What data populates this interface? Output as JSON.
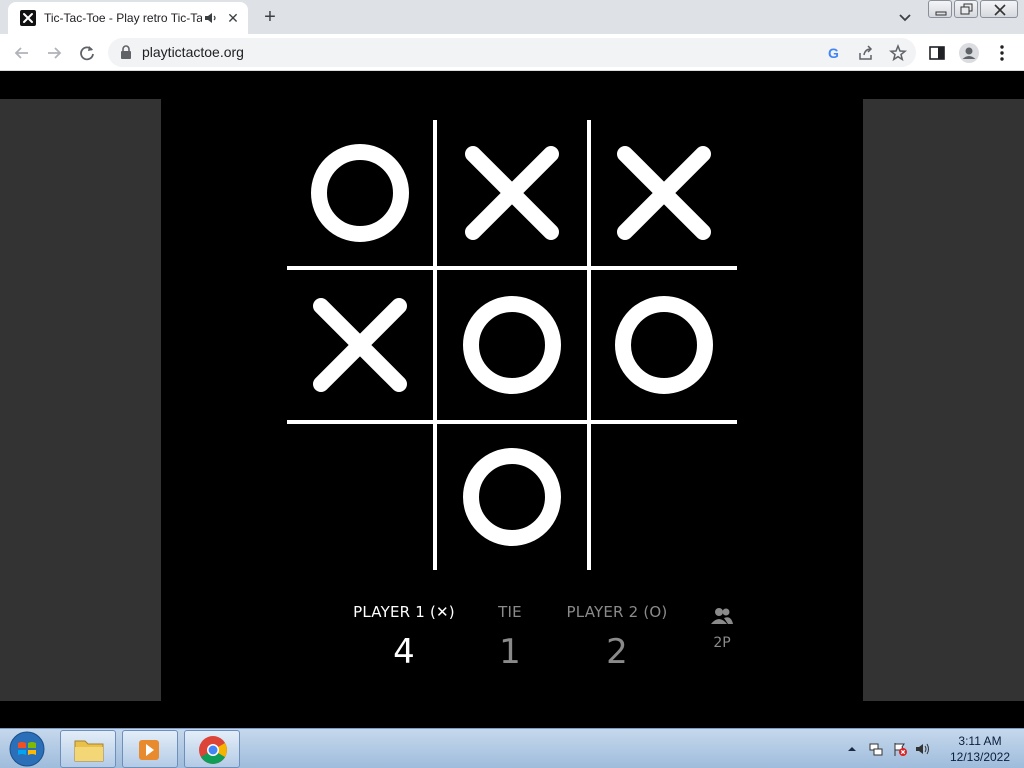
{
  "browser": {
    "tab_title": "Tic-Tac-Toe - Play retro Tic-Tac-Toe online for free",
    "tab_close_glyph": "✕",
    "new_tab_glyph": "+",
    "url": "playtictactoe.org"
  },
  "game": {
    "board": [
      "O",
      "X",
      "X",
      "X",
      "O",
      "O",
      "",
      "O",
      ""
    ],
    "colors": {
      "background": "#000000",
      "marks": "#ffffff",
      "side_panels": "#333333",
      "inactive_text": "#8a8a8a"
    },
    "scores": [
      {
        "label": "PLAYER 1 (✕)",
        "value": "4",
        "active": true
      },
      {
        "label": "TIE",
        "value": "1",
        "active": false
      },
      {
        "label": "PLAYER 2 (O)",
        "value": "2",
        "active": false
      }
    ],
    "mode": {
      "label": "2P",
      "icon": "two-players-icon"
    }
  },
  "taskbar": {
    "time": "3:11 AM",
    "date": "12/13/2022"
  }
}
